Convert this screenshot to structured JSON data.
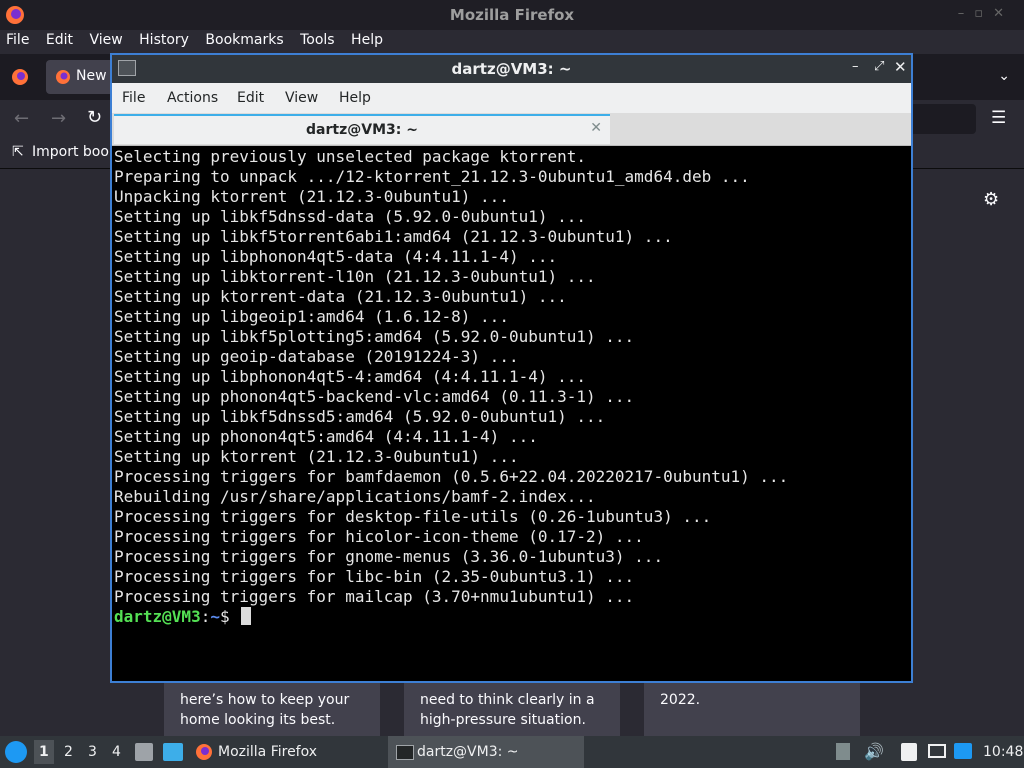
{
  "firefox": {
    "title": "Mozilla Firefox",
    "menu": [
      "File",
      "Edit",
      "View",
      "History",
      "Bookmarks",
      "Tools",
      "Help"
    ],
    "tab_label": "New",
    "bookmark": "Import book",
    "cards": [
      "here’s how to keep your home looking its best.",
      "need to think clearly in a high-pressure situation.",
      "2022."
    ]
  },
  "terminal": {
    "title": "dartz@VM3: ~",
    "menu": [
      "File",
      "Actions",
      "Edit",
      "View",
      "Help"
    ],
    "tab_label": "dartz@VM3: ~",
    "lines": [
      "Selecting previously unselected package ktorrent.",
      "Preparing to unpack .../12-ktorrent_21.12.3-0ubuntu1_amd64.deb ...",
      "Unpacking ktorrent (21.12.3-0ubuntu1) ...",
      "Setting up libkf5dnssd-data (5.92.0-0ubuntu1) ...",
      "Setting up libkf5torrent6abi1:amd64 (21.12.3-0ubuntu1) ...",
      "Setting up libphonon4qt5-data (4:4.11.1-4) ...",
      "Setting up libktorrent-l10n (21.12.3-0ubuntu1) ...",
      "Setting up ktorrent-data (21.12.3-0ubuntu1) ...",
      "Setting up libgeoip1:amd64 (1.6.12-8) ...",
      "Setting up libkf5plotting5:amd64 (5.92.0-0ubuntu1) ...",
      "Setting up geoip-database (20191224-3) ...",
      "Setting up libphonon4qt5-4:amd64 (4:4.11.1-4) ...",
      "Setting up phonon4qt5-backend-vlc:amd64 (0.11.3-1) ...",
      "Setting up libkf5dnssd5:amd64 (5.92.0-0ubuntu1) ...",
      "Setting up phonon4qt5:amd64 (4:4.11.1-4) ...",
      "Setting up ktorrent (21.12.3-0ubuntu1) ...",
      "Processing triggers for bamfdaemon (0.5.6+22.04.20220217-0ubuntu1) ...",
      "Rebuilding /usr/share/applications/bamf-2.index...",
      "Processing triggers for desktop-file-utils (0.26-1ubuntu3) ...",
      "Processing triggers for hicolor-icon-theme (0.17-2) ...",
      "Processing triggers for gnome-menus (3.36.0-1ubuntu3) ...",
      "Processing triggers for libc-bin (2.35-0ubuntu3.1) ...",
      "Processing triggers for mailcap (3.70+nmu1ubuntu1) ..."
    ],
    "prompt_user": "dartz@VM3",
    "prompt_sep": ":",
    "prompt_path": "~",
    "prompt_symbol": "$"
  },
  "taskbar": {
    "workspaces": [
      "1",
      "2",
      "3",
      "4"
    ],
    "tasks": [
      "Mozilla Firefox",
      "dartz@VM3: ~"
    ],
    "clock": "10:48"
  }
}
